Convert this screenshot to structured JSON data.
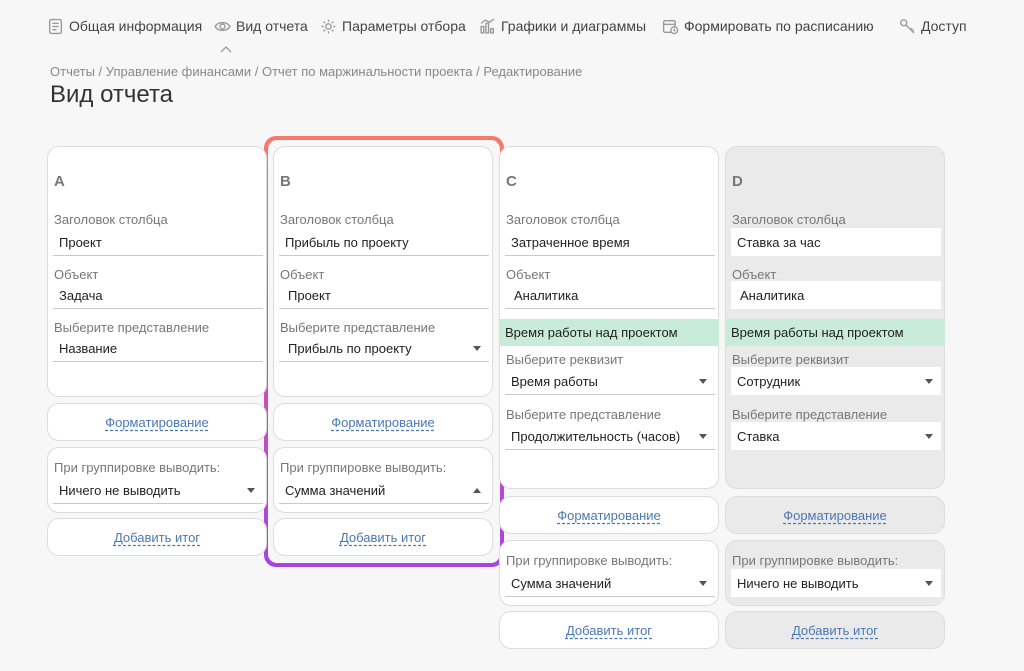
{
  "nav": {
    "items": [
      {
        "label": "Общая информация",
        "icon": "document-icon"
      },
      {
        "label": "Вид отчета",
        "icon": "eye-icon"
      },
      {
        "label": "Параметры отбора",
        "icon": "gear-icon"
      },
      {
        "label": "Графики и диаграммы",
        "icon": "chart-icon"
      },
      {
        "label": "Формировать по расписанию",
        "icon": "calendar-clock-icon"
      },
      {
        "label": "Доступ",
        "icon": "key-icon"
      }
    ]
  },
  "breadcrumb": {
    "items": [
      "Отчеты",
      "Управление финансами",
      "Отчет по маржинальности проекта",
      "Редактирование"
    ],
    "separator": " / "
  },
  "page": {
    "title": "Вид отчета"
  },
  "columns": [
    {
      "letter": "A",
      "header_label": "Заголовок столбца",
      "header_value": "Проект",
      "object_label": "Объект",
      "object_value": "Задача",
      "view_label": "Выберите представление",
      "view_value": "Название",
      "formatting": "Форматирование",
      "group_label": "При группировке выводить:",
      "group_value": "Ничего не выводить",
      "add_total": "Добавить итог"
    },
    {
      "letter": "B",
      "header_label": "Заголовок столбца",
      "header_value": "Прибыль по проекту",
      "object_label": "Объект",
      "object_value": "Проект",
      "view_label": "Выберите представление",
      "view_value": "Прибыль по проекту",
      "formatting": "Форматирование",
      "group_label": "При группировке выводить:",
      "group_value": "Сумма значений",
      "add_total": "Добавить итог"
    },
    {
      "letter": "C",
      "header_label": "Заголовок столбца",
      "header_value": "Затраченное время",
      "object_label": "Объект",
      "object_value": "Аналитика",
      "analytic_bar": "Время работы над проектом",
      "attr_label": "Выберите реквизит",
      "attr_value": "Время работы",
      "view_label": "Выберите представление",
      "view_value": "Продолжительность (часов)",
      "formatting": "Форматирование",
      "group_label": "При группировке выводить:",
      "group_value": "Сумма значений",
      "add_total": "Добавить итог"
    },
    {
      "letter": "D",
      "header_label": "Заголовок столбца",
      "header_value": "Ставка за час",
      "object_label": "Объект",
      "object_value": "Аналитика",
      "analytic_bar": "Время работы над проектом",
      "attr_label": "Выберите реквизит",
      "attr_value": "Сотрудник",
      "view_label": "Выберите представление",
      "view_value": "Ставка",
      "formatting": "Форматирование",
      "group_label": "При группировке выводить:",
      "group_value": "Ничего не выводить",
      "add_total": "Добавить итог"
    }
  ],
  "colors": {
    "accent_link": "#4a78b5",
    "analytic_bar": "#c8ecd9",
    "highlight_gradient": [
      "#f47a6e",
      "#d04fb0",
      "#a644e3"
    ]
  }
}
